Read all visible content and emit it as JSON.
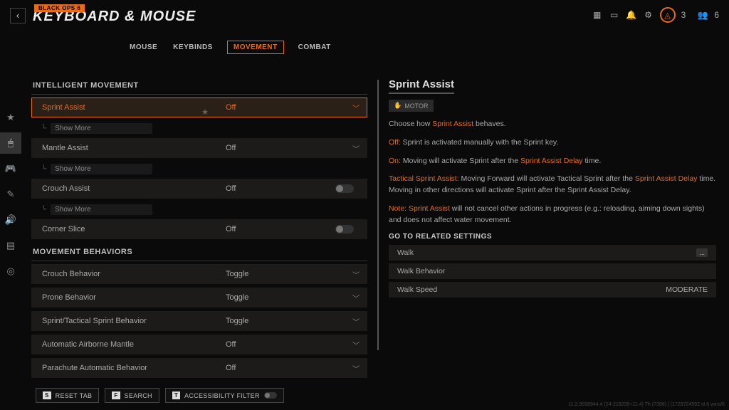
{
  "header": {
    "game_tag": "BLACK OPS 6",
    "title": "KEYBOARD & MOUSE",
    "party_count": "3",
    "friends_count": "6"
  },
  "tabs": [
    "MOUSE",
    "KEYBINDS",
    "MOVEMENT",
    "COMBAT"
  ],
  "sections": {
    "intelligent_movement": {
      "title": "INTELLIGENT MOVEMENT",
      "sprint_assist": {
        "label": "Sprint Assist",
        "value": "Off"
      },
      "show_more_1": "Show More",
      "mantle_assist": {
        "label": "Mantle Assist",
        "value": "Off"
      },
      "show_more_2": "Show More",
      "crouch_assist": {
        "label": "Crouch Assist",
        "value": "Off"
      },
      "show_more_3": "Show More",
      "corner_slice": {
        "label": "Corner Slice",
        "value": "Off"
      }
    },
    "movement_behaviors": {
      "title": "MOVEMENT BEHAVIORS",
      "crouch_behavior": {
        "label": "Crouch Behavior",
        "value": "Toggle"
      },
      "prone_behavior": {
        "label": "Prone Behavior",
        "value": "Toggle"
      },
      "sprint_behavior": {
        "label": "Sprint/Tactical Sprint Behavior",
        "value": "Toggle"
      },
      "airborne_mantle": {
        "label": "Automatic Airborne Mantle",
        "value": "Off"
      },
      "parachute": {
        "label": "Parachute Automatic Behavior",
        "value": "Off"
      }
    }
  },
  "description": {
    "title": "Sprint Assist",
    "motor": "MOTOR",
    "intro_pre": "Choose how ",
    "intro_hl": "Sprint Assist",
    "intro_post": " behaves.",
    "off_label": "Off:",
    "off_text": " Sprint is activated manually with the Sprint key.",
    "on_label": "On:",
    "on_text_pre": " Moving will activate Sprint after the ",
    "on_text_hl": "Sprint Assist Delay",
    "on_text_post": " time.",
    "tac_label": "Tactical Sprint Assist:",
    "tac_text_pre": " Moving Forward will activate Tactical Sprint after the ",
    "tac_text_hl": "Sprint Assist Delay",
    "tac_text_post": " time. Moving in other directions will activate Sprint after the Sprint Assist Delay.",
    "note_label": "Note:",
    "note_hl": " Sprint Assist",
    "note_text": " will not cancel other actions in progress (e.g.: reloading, aiming down sights) and does not affect water movement.",
    "related_title": "GO TO RELATED SETTINGS",
    "related": {
      "walk": {
        "label": "Walk",
        "badge": "..."
      },
      "walk_behavior": {
        "label": "Walk Behavior",
        "value": ""
      },
      "walk_speed": {
        "label": "Walk Speed",
        "value": "MODERATE"
      }
    }
  },
  "footer": {
    "reset_key": "S",
    "reset": "RESET TAB",
    "search_key": "F",
    "search": "SEARCH",
    "access_key": "T",
    "access": "ACCESSIBILITY FILTER"
  },
  "build": "11.2.9938944.4 (24-218235+11.4) Th (7398) | (1729724592 st.6 wins/6"
}
